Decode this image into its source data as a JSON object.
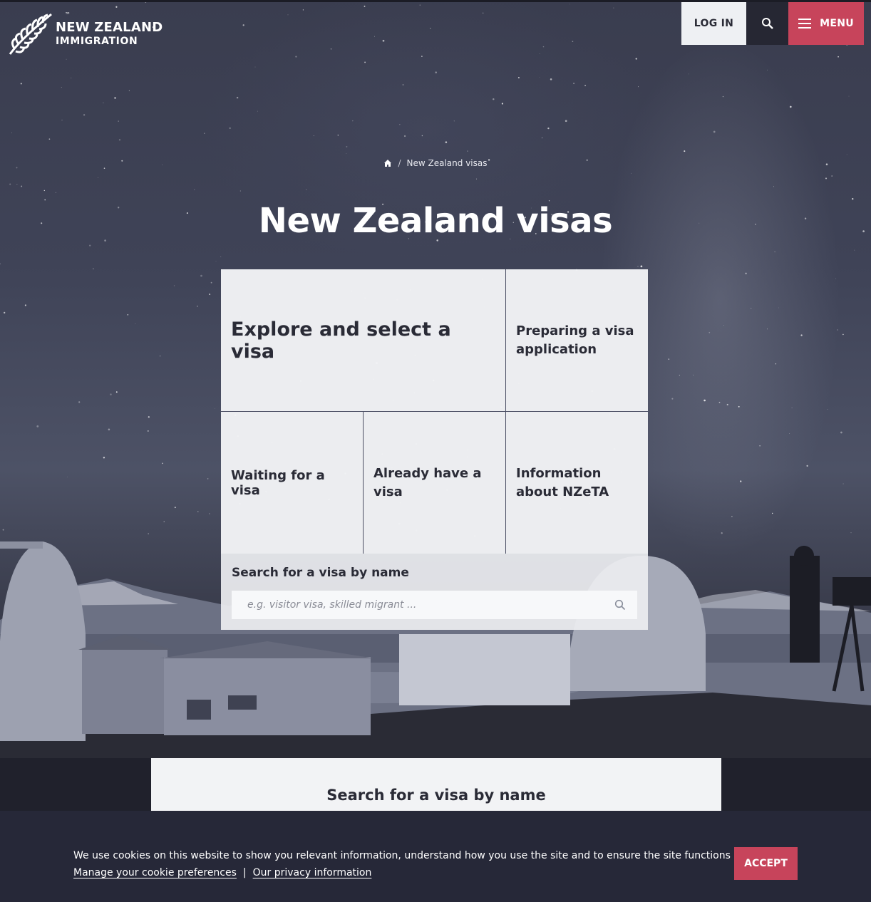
{
  "header": {
    "logo_line1": "NEW ZEALAND",
    "logo_line2": "IMMIGRATION",
    "logo_mark": "™",
    "login_label": "LOG IN",
    "menu_label": "MENU",
    "search_icon": "search-icon",
    "accent_color": "#c7445b"
  },
  "breadcrumb": {
    "home_icon": "home-icon",
    "separator": "/",
    "current": "New Zealand visas"
  },
  "page": {
    "title": "New Zealand visas"
  },
  "tiles": [
    {
      "label": "Explore and select a visa"
    },
    {
      "label": "Preparing a visa application"
    },
    {
      "label": "Waiting for a visa"
    },
    {
      "label": "Already have a visa"
    },
    {
      "label": "Information about NZeTA"
    }
  ],
  "search": {
    "label": "Search for a visa by name",
    "placeholder": "e.g. visitor visa, skilled migrant ...",
    "icon": "search-icon"
  },
  "lower_section": {
    "title": "Search for a visa by name"
  },
  "cookie_banner": {
    "text": "We use cookies on this website to show you relevant information, understand how you use the site and to ensure the site functions properly.",
    "manage_link": "Manage your cookie preferences",
    "separator": "|",
    "privacy_link": "Our privacy information",
    "accept_label": "ACCEPT"
  }
}
